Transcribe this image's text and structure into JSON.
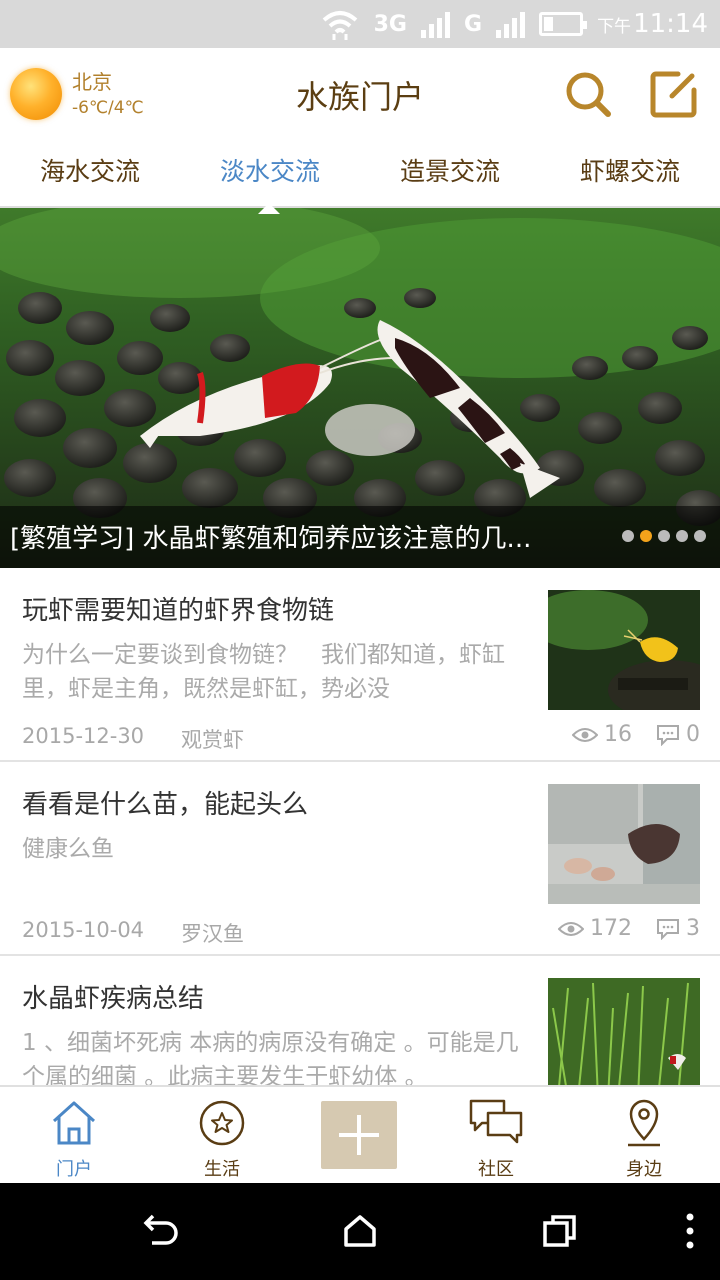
{
  "status_bar": {
    "network_3g": "3G",
    "network_g": "G",
    "time_prefix": "下午",
    "time": "11:14"
  },
  "header": {
    "weather": {
      "city": "北京",
      "temperature": "-6℃/4℃",
      "icon": "sun-icon"
    },
    "title": "水族门户",
    "search_icon": "search-icon",
    "compose_icon": "compose-icon",
    "accent_color": "#b8862b"
  },
  "tabs": [
    {
      "label": "海水交流",
      "active": false
    },
    {
      "label": "淡水交流",
      "active": true
    },
    {
      "label": "造景交流",
      "active": false
    },
    {
      "label": "虾螺交流",
      "active": false
    }
  ],
  "banner": {
    "caption": "[繁殖学习] 水晶虾繁殖和饲养应该注意的几...",
    "dots": 5,
    "active_dot": 2
  },
  "articles": [
    {
      "title": "玩虾需要知道的虾界食物链",
      "summary": "为什么一定要谈到食物链？　我们都知道，虾缸里，虾是主角，既然是虾缸，势必没",
      "date": "2015-12-30",
      "tag": "观赏虾",
      "views": "16",
      "comments": "0"
    },
    {
      "title": "看看是什么苗，能起头么",
      "summary": "健康么鱼",
      "date": "2015-10-04",
      "tag": "罗汉鱼",
      "views": "172",
      "comments": "3"
    },
    {
      "title": "水晶虾疾病总结",
      "summary": "1 、细菌坏死病  本病的病原没有确定 。可能是几个属的细菌 。此病主要发生于虾幼体 。",
      "date": "",
      "tag": "",
      "views": "",
      "comments": ""
    }
  ],
  "bottom_nav": [
    {
      "label": "门户",
      "icon": "home-icon",
      "active": true
    },
    {
      "label": "生活",
      "icon": "star-circle-icon",
      "active": false
    },
    {
      "label": "",
      "icon": "plus-icon",
      "active": false
    },
    {
      "label": "社区",
      "icon": "chat-bubbles-icon",
      "active": false
    },
    {
      "label": "身边",
      "icon": "location-pin-icon",
      "active": false
    }
  ],
  "system_nav": [
    "back-icon",
    "home-outline-icon",
    "recents-icon",
    "more-icon"
  ]
}
